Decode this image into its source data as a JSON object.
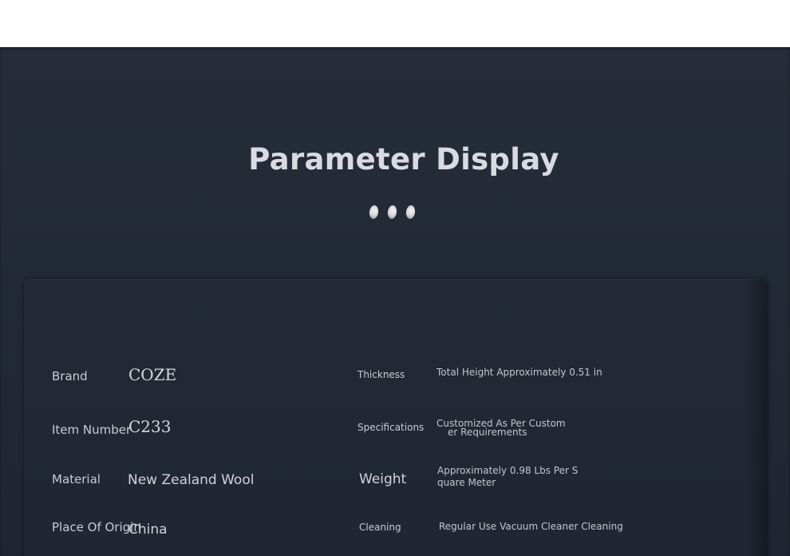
{
  "header": {
    "title": "Parameter Display"
  },
  "specs_left": [
    {
      "label": "Brand",
      "value": "COZE"
    },
    {
      "label": "Item Number",
      "value": "C233"
    },
    {
      "label": "Material",
      "value": "New Zealand Wool"
    },
    {
      "label": "Place Of Origin",
      "value": "China"
    }
  ],
  "specs_right": [
    {
      "label": "Thickness",
      "value": "Total Height Approximately 0.51 in"
    },
    {
      "label": "Specifications",
      "value_line1": "Customized As Per Custom",
      "value_line2": "er Requirements"
    },
    {
      "label": "Weight",
      "value_line1": "Approximately 0.98 Lbs Per S",
      "value_line2": "quare Meter"
    },
    {
      "label": "Cleaning",
      "value": "Regular Use Vacuum Cleaner Cleaning"
    }
  ]
}
